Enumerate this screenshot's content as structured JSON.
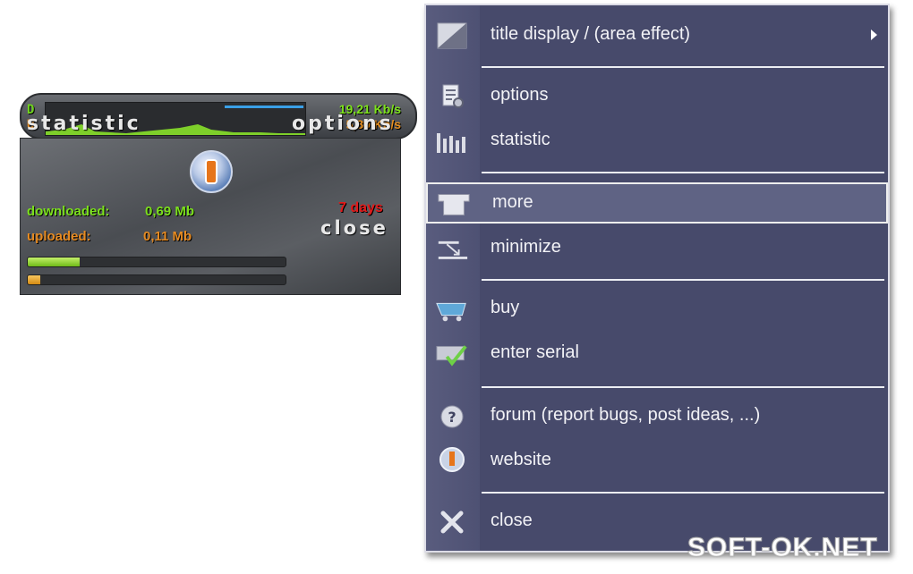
{
  "widget": {
    "d_label": "D",
    "u_label": "U",
    "download_rate": "19,21 Kb/s",
    "upload_rate": "5,89 Kb/s",
    "statistic_label": "statistic",
    "options_label": "options",
    "downloaded_label": "downloaded:",
    "downloaded_value": "0,69 Mb",
    "uploaded_label": "uploaded:",
    "uploaded_value": "0,11 Mb",
    "days_left": "7 days",
    "close_label": "close",
    "download_progress": 0.2,
    "upload_progress": 0.05,
    "colors": {
      "download": "#7be01c",
      "upload": "#e58a22",
      "days": "#e21a1a"
    }
  },
  "menu": {
    "items": [
      {
        "label": "title display / (area effect)",
        "icon": "title-display-icon",
        "submenu": true
      },
      {
        "label": "options",
        "icon": "options-icon"
      },
      {
        "label": "statistic",
        "icon": "statistic-icon"
      },
      {
        "label": "more",
        "icon": "more-icon",
        "selected": true
      },
      {
        "label": "minimize",
        "icon": "minimize-icon"
      },
      {
        "label": "buy",
        "icon": "cart-icon"
      },
      {
        "label": "enter serial",
        "icon": "serial-icon"
      },
      {
        "label": "forum (report bugs, post ideas, ...)",
        "icon": "help-icon"
      },
      {
        "label": "website",
        "icon": "website-icon"
      },
      {
        "label": "close",
        "icon": "close-icon"
      }
    ],
    "colors": {
      "background": "#474a6b",
      "text": "#f2f2f6",
      "selected": "#5f6384"
    }
  },
  "watermark": "SOFT-OK.NET"
}
